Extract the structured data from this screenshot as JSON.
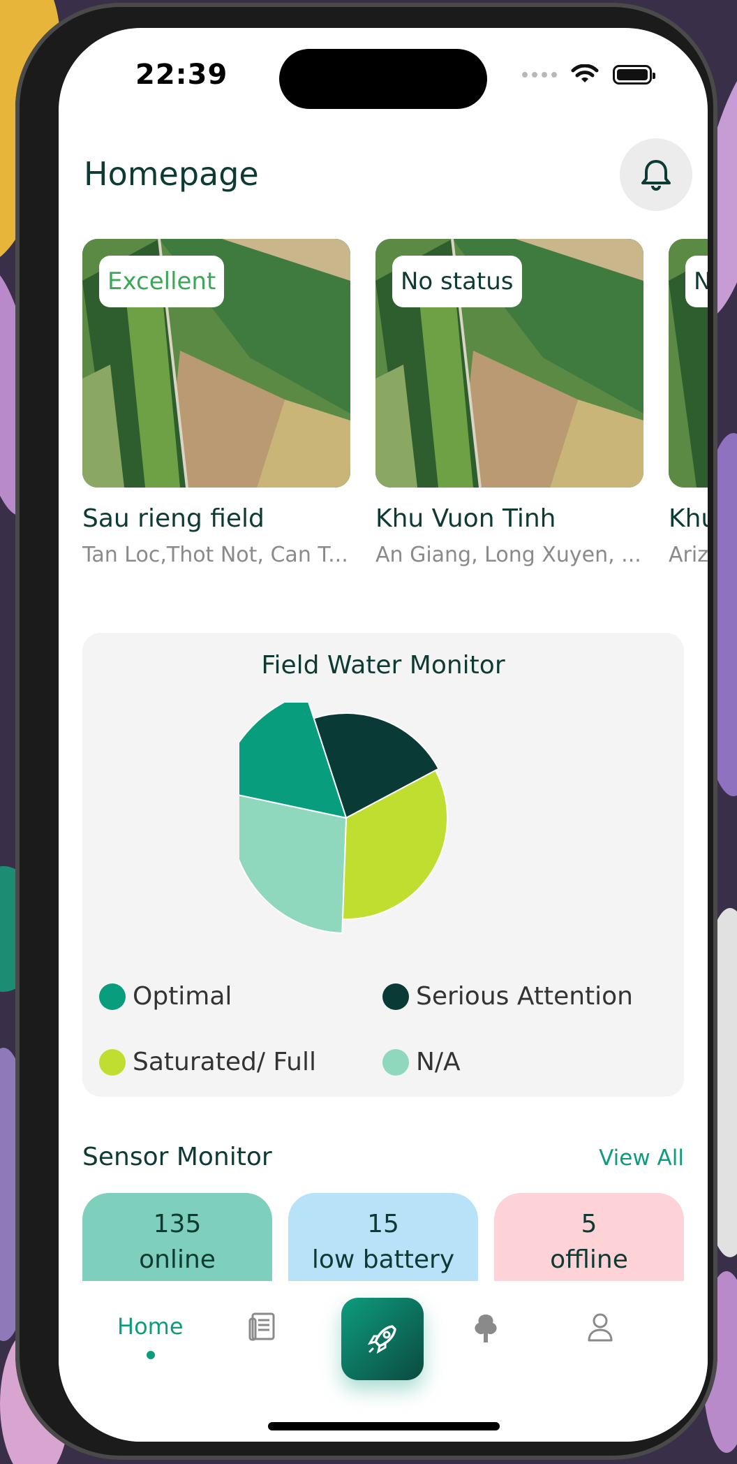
{
  "status_bar": {
    "time": "22:39"
  },
  "header": {
    "title": "Homepage"
  },
  "fields": [
    {
      "status": "Excellent",
      "status_color": "#3aa957",
      "name": "Sau rieng field",
      "location": "Tan Loc,Thot Not, Can T..."
    },
    {
      "status": "No status",
      "status_color": "#0d3b34",
      "name": "Khu Vuon Tinh",
      "location": "An Giang, Long Xuyen, ..."
    },
    {
      "status": "N",
      "status_color": "#0d3b34",
      "name": "Khu",
      "location": "Ariz"
    }
  ],
  "water_monitor": {
    "title": "Field Water Monitor",
    "legend": [
      {
        "label": "Optimal",
        "color": "#089e7d"
      },
      {
        "label": "Serious Attention",
        "color": "#0a3a36"
      },
      {
        "label": "Saturated/ Full",
        "color": "#c0de2f"
      },
      {
        "label": "N/A",
        "color": "#8fd7bd"
      }
    ]
  },
  "chart_data": {
    "type": "pie",
    "title": "Field Water Monitor",
    "series": [
      {
        "name": "Serious Attention",
        "value": 20,
        "color": "#0a3a36"
      },
      {
        "name": "Saturated/ Full",
        "value": 30,
        "color": "#c0de2f"
      },
      {
        "name": "N/A",
        "value": 25,
        "color": "#8fd7bd"
      },
      {
        "name": "Optimal",
        "value": 15,
        "color": "#089e7d"
      }
    ]
  },
  "sensor_monitor": {
    "title": "Sensor Monitor",
    "view_all": "View All",
    "cards": [
      {
        "count": "135",
        "label": "online",
        "color": "#7fcfbd"
      },
      {
        "count": "15",
        "label": "low battery",
        "color": "#b7e2f7"
      },
      {
        "count": "5",
        "label": "offline",
        "color": "#fdd3d7"
      }
    ]
  },
  "nav": {
    "home": "Home"
  }
}
